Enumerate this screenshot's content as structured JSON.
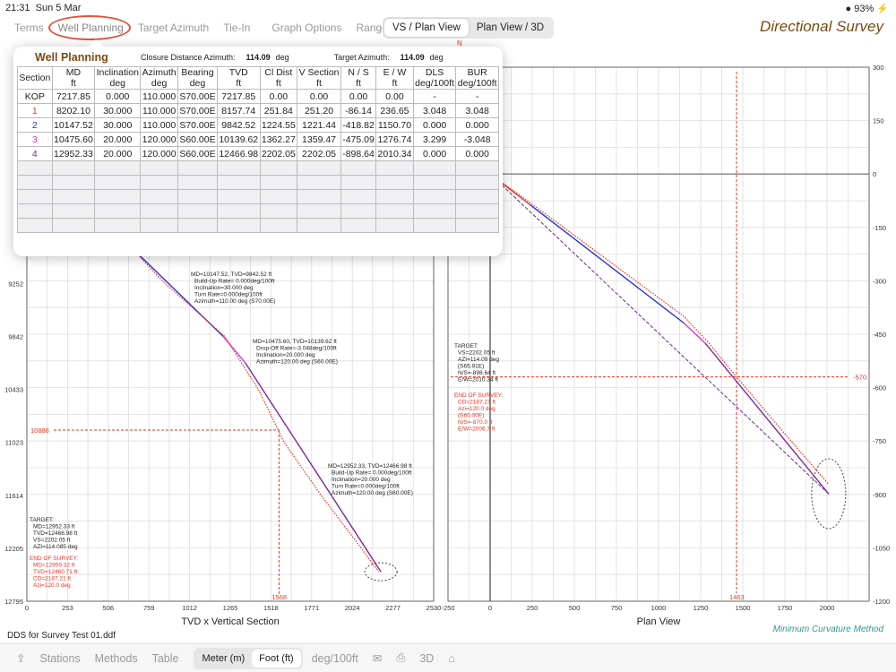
{
  "status": {
    "time": "21:31",
    "date": "Sun 5 Mar",
    "battery": "93%"
  },
  "tabs": [
    "Terms",
    "Well Planning",
    "Target Azimuth",
    "Tie-In",
    "Graph Options",
    "Ranges"
  ],
  "view_toggle": {
    "options": [
      "VS / Plan View",
      "Plan View / 3D"
    ],
    "selected": "VS / Plan View"
  },
  "app_title": "Directional Survey",
  "popup": {
    "title": "Well Planning",
    "closure_label": "Closure Distance Azimuth:",
    "closure_value": "114.09",
    "closure_unit": "deg",
    "target_label": "Target Azimuth:",
    "target_value": "114.09",
    "target_unit": "deg",
    "columns": [
      [
        "Section",
        ""
      ],
      [
        "MD",
        "ft"
      ],
      [
        "Inclination",
        "deg"
      ],
      [
        "Azimuth",
        "deg"
      ],
      [
        "Bearing",
        "deg"
      ],
      [
        "TVD",
        "ft"
      ],
      [
        "Cl Dist",
        "ft"
      ],
      [
        "V Section",
        "ft"
      ],
      [
        "N / S",
        "ft"
      ],
      [
        "E / W",
        "ft"
      ],
      [
        "DLS",
        "deg/100ft"
      ],
      [
        "BUR",
        "deg/100ft"
      ]
    ],
    "rows": [
      [
        "KOP",
        "7217.85",
        "0.000",
        "110.000",
        "S70.00E",
        "7217.85",
        "0.00",
        "0.00",
        "0.00",
        "0.00",
        "-",
        "-"
      ],
      [
        "1",
        "8202.10",
        "30.000",
        "110.000",
        "S70.00E",
        "8157.74",
        "251.84",
        "251.20",
        "-86.14",
        "236.65",
        "3.048",
        "3.048"
      ],
      [
        "2",
        "10147.52",
        "30.000",
        "110.000",
        "S70.00E",
        "9842.52",
        "1224.55",
        "1221.44",
        "-418.82",
        "1150.70",
        "0.000",
        "0.000"
      ],
      [
        "3",
        "10475.60",
        "20.000",
        "120.000",
        "S60.00E",
        "10139.62",
        "1362.27",
        "1359.47",
        "-475.09",
        "1276.74",
        "3.299",
        "-3.048"
      ],
      [
        "4",
        "12952.33",
        "20.000",
        "120.000",
        "S60.00E",
        "12466.98",
        "2202.05",
        "2202.05",
        "-898.64",
        "2010.34",
        "0.000",
        "0.000"
      ]
    ],
    "section_colors": [
      "#222222",
      "#e53935",
      "#2233dd",
      "#dd33dd",
      "#7b2a9a"
    ]
  },
  "file_name": "DDS for Survey Test 01.ddf",
  "method": "Minimum Curvature Method",
  "bottom": {
    "stations": "Stations",
    "methods": "Methods",
    "table": "Table",
    "units": [
      "Meter (m)",
      "Foot (ft)"
    ],
    "unit_selected": "Foot (ft)",
    "dls_unit": "deg/100ft",
    "three_d": "3D"
  },
  "chart_data": [
    {
      "type": "line",
      "title": "TVD x Vertical Section",
      "xlim": [
        0,
        2530
      ],
      "ylim": [
        6840,
        12795
      ],
      "y_inverted": true,
      "grid": true,
      "xticks": [
        "0",
        "253",
        "506",
        "759",
        "1012",
        "1265",
        "1518",
        "1771",
        "2024",
        "2277",
        "2530"
      ],
      "yticks": [
        "9252",
        "9842",
        "10433",
        "11023",
        "11614",
        "12205",
        "12795"
      ],
      "plan": {
        "x": [
          0,
          251.2,
          1221.44,
          1359.47,
          2202.05
        ],
        "y": [
          7217.85,
          8157.74,
          9842.52,
          10139.62,
          12466.98
        ],
        "segment_colors": [
          "#e53935",
          "#2233dd",
          "#dd33dd",
          "#7b2a9a"
        ]
      },
      "survey": {
        "x": [
          0,
          300,
          860,
          1230,
          1440,
          1600,
          1830,
          2080,
          2187
        ],
        "y": [
          7218,
          8200,
          9252,
          9842,
          10433,
          11023,
          11614,
          12205,
          12461
        ],
        "color": "#ee3322"
      },
      "crosshair": {
        "x": 1568,
        "y": 10886,
        "x_label": "1568",
        "y_label": "10886"
      },
      "annotations": [
        [
          "MD=10147.52, TVD=9842.52 ft",
          "Build-Up Rate= 0.000deg/100ft",
          "Inclination=30.000 deg",
          "Turn Rate=0.000deg/100ft",
          "Azimuth=110.00 deg (S70.00E)"
        ],
        [
          "MD=10475.60, TVD=10139.62 ft",
          "Drop-Off Rate=-3.048deg/100ft",
          "Inclination=20.000 deg",
          "Azimuth=120.00 deg (S60.00E)"
        ],
        [
          "MD=12952.33, TVD=12466.98 ft",
          "Build-Up Rate= 0.000deg/100ft",
          "Inclination=20.000 deg",
          "Turn Rate=0.000deg/100ft",
          "Azimuth=120.00 deg (S60.00E)"
        ]
      ],
      "target_box": [
        "TARGET:",
        "MD=12952.33 ft",
        "TVD=12466.98 ft",
        "VS=2202.05 ft",
        "AZI=114.085 deg"
      ],
      "end_box": [
        "END OF SURVEY:",
        "MD=12959.32  ft",
        "TVD=12460.71  ft",
        "CD=2187.21  ft",
        "Azi=120.0 deg"
      ]
    },
    {
      "type": "line",
      "title": "Plan View",
      "xlim": [
        -250,
        2250
      ],
      "ylim": [
        -1200,
        300
      ],
      "grid": true,
      "xticks": [
        "-250",
        "0",
        "250",
        "500",
        "750",
        "1000",
        "1250",
        "1500",
        "1750",
        "2000"
      ],
      "yticks": [
        "300",
        "150",
        "0",
        "-150",
        "-300",
        "-450",
        "-600",
        "-750",
        "-900",
        "-1050",
        "-1200"
      ],
      "north_label": "N",
      "plan": {
        "x": [
          0,
          236.65,
          1150.7,
          1276.74,
          2010.34
        ],
        "y": [
          0,
          -86.14,
          -418.82,
          -475.09,
          -898.64
        ]
      },
      "target_line": {
        "x": [
          0,
          2010.34
        ],
        "y": [
          0,
          -898.64
        ],
        "color": "#6a2a8a"
      },
      "survey": {
        "x": [
          0,
          236,
          1150,
          1290,
          1463,
          1750,
          2007
        ],
        "y": [
          0,
          -80,
          -400,
          -470,
          -570,
          -730,
          -870
        ]
      },
      "crosshair": {
        "x": 1463,
        "y": -570,
        "x_label": "1463",
        "y_label": "-570"
      },
      "target_box": [
        "TARGET:",
        "VS=2202.05 ft",
        "AZI=114.09 deg",
        "(S65.91E)",
        "N/S=-898.64 ft",
        "E/W=2010.34 ft"
      ],
      "end_box": [
        "END OF SURVEY:",
        "CD=2187.21  ft",
        "Azi=120.0 deg",
        "(S60.00E)",
        "N/S=-870.0  ft",
        "E/W=2006.7  ft"
      ]
    }
  ]
}
